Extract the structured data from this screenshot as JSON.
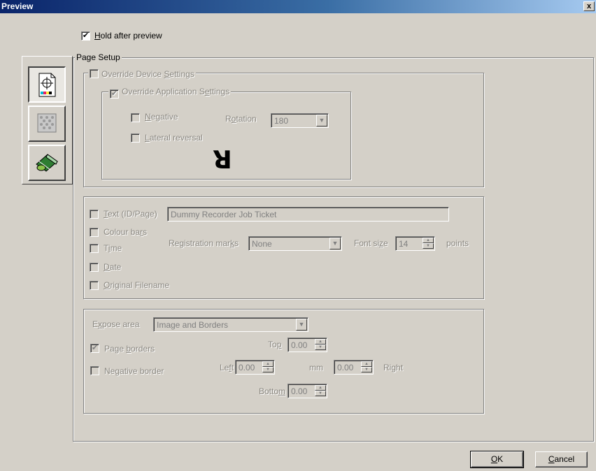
{
  "window": {
    "title": "Preview",
    "close_glyph": "x"
  },
  "hold_after_preview": {
    "label_accel": "H",
    "label_rest": "old after preview",
    "checked": true
  },
  "page_setup": {
    "title": "Page Setup",
    "override_device": {
      "label_pre": "Override Device ",
      "label_accel": "S",
      "label_post": "ettings",
      "checked": false
    },
    "override_app": {
      "label_pre": "Override Application S",
      "label_accel": "e",
      "label_post": "ttings",
      "checked": true
    },
    "negative": {
      "label_accel": "N",
      "label_rest": "egative",
      "checked": false
    },
    "lateral_reversal": {
      "label_accel": "L",
      "label_rest": "ateral reversal",
      "checked": false
    },
    "rotation": {
      "label_pre": "R",
      "label_accel": "o",
      "label_post": "tation",
      "value": "180"
    },
    "rotation_preview_glyph": "R"
  },
  "annotations": {
    "text_id_page": {
      "label_accel": "T",
      "label_rest": "ext (ID/Page)",
      "value": "Dummy Recorder Job Ticket",
      "checked": false
    },
    "colour_bars": {
      "label_pre": "Colour ba",
      "label_accel": "r",
      "label_post": "s",
      "checked": false
    },
    "time": {
      "label_pre": "T",
      "label_accel": "i",
      "label_post": "me",
      "checked": false
    },
    "date": {
      "label_accel": "D",
      "label_rest": "ate",
      "checked": false
    },
    "original_filename": {
      "label_accel": "O",
      "label_rest": "riginal Filename",
      "checked": false
    },
    "registration_marks": {
      "label_pre": "Registration mar",
      "label_accel": "k",
      "label_post": "s",
      "value": "None"
    },
    "font_size": {
      "label_pre": "Font si",
      "label_accel": "z",
      "label_post": "e",
      "value": "14",
      "unit": "points"
    }
  },
  "expose": {
    "expose_area": {
      "label_pre": "E",
      "label_accel": "x",
      "label_post": "pose area",
      "value": "Image and Borders"
    },
    "page_borders": {
      "label_pre": "Page ",
      "label_accel": "b",
      "label_post": "orders",
      "checked": true
    },
    "negative_border": {
      "label_pre": "Ne",
      "label_accel": "g",
      "label_post": "ative border",
      "checked": false
    },
    "top": {
      "label_pre": "To",
      "label_accel": "p",
      "value": "0.00"
    },
    "left": {
      "label_pre": "Le",
      "label_accel": "f",
      "label_post": "t",
      "value": "0.00"
    },
    "unit": "mm",
    "right": {
      "label_pre": "Ri",
      "label_accel": "g",
      "label_post": "ht",
      "value": "0.00"
    },
    "bottom": {
      "label_pre": "Botto",
      "label_accel": "m",
      "value": "0.00"
    }
  },
  "buttons": {
    "ok": {
      "accel": "O",
      "rest": "K"
    },
    "cancel": {
      "accel": "C",
      "rest": "ancel"
    }
  },
  "tabs": [
    {
      "icon": "page-setup-icon",
      "active": true
    },
    {
      "icon": "halftone-icon",
      "active": false
    },
    {
      "icon": "film-roll-icon",
      "active": false
    }
  ]
}
